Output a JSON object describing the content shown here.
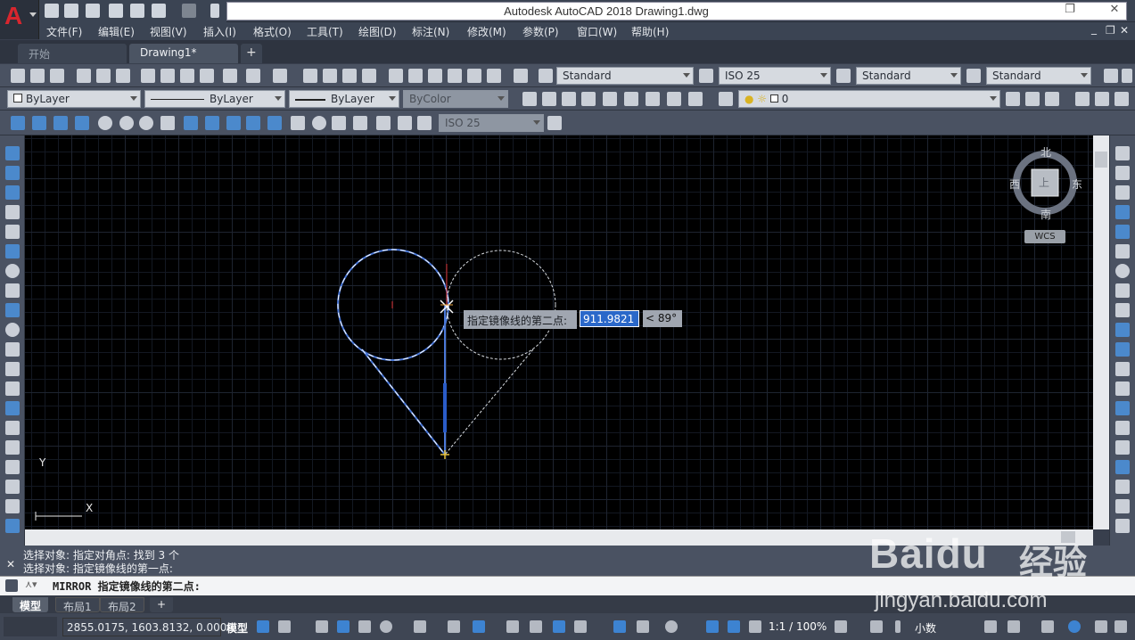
{
  "app": {
    "title": "Autodesk AutoCAD 2018    Drawing1.dwg",
    "logo_letter": "A",
    "win_restore": "❐",
    "win_close": "✕",
    "doc_minimize": "_",
    "doc_restore": "❐",
    "doc_close": "✕"
  },
  "menu": [
    "文件(F)",
    "编辑(E)",
    "视图(V)",
    "插入(I)",
    "格式(O)",
    "工具(T)",
    "绘图(D)",
    "标注(N)",
    "修改(M)",
    "参数(P)",
    "窗口(W)",
    "帮助(H)"
  ],
  "tabs": {
    "start": "开始",
    "drawing": "Drawing1*",
    "add": "+"
  },
  "styles": {
    "text_style": "Standard",
    "dim_style": "ISO 25",
    "table_style": "Standard",
    "mleader_style": "Standard"
  },
  "properties": {
    "color": "ByLayer",
    "linetype": "ByLayer",
    "lineweight": "ByLayer",
    "plotstyle": "ByColor",
    "layer": "0",
    "dim_style_2": "ISO 25"
  },
  "dynamic_input": {
    "prompt": "指定镜像线的第二点:",
    "value": "911.9821",
    "angle": "< 89°"
  },
  "viewcube": {
    "north": "北",
    "south": "南",
    "east": "东",
    "west": "西",
    "face": "上",
    "wcs": "WCS"
  },
  "ucs": {
    "y_label": "Y",
    "x_label": "X"
  },
  "command": {
    "history": [
      "选择对象:  指定对角点: 找到 3 个",
      "选择对象:   指定镜像线的第一点:"
    ],
    "current": "MIRROR 指定镜像线的第二点:",
    "close_icon": "✕",
    "wrench_icon": "🔧"
  },
  "layout_tabs": [
    "模型",
    "布局1",
    "布局2",
    "+"
  ],
  "status": {
    "coords": "2855.0175, 1603.8132, 0.0000",
    "model": "模型",
    "scale": "1:1 / 100%",
    "units": "小数"
  },
  "watermark": {
    "brand": "Baidu",
    "cn": "经验",
    "url": "jingyan.baidu.com"
  },
  "colors": {
    "accent": "#2b68c9",
    "logo_red": "#d8262e",
    "canvas": "#000000",
    "selected_line": "#4a78d8"
  }
}
